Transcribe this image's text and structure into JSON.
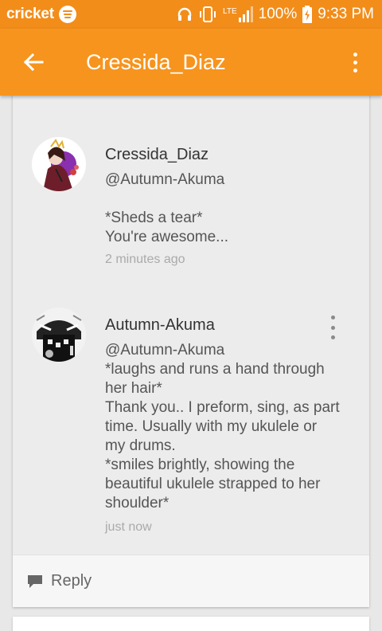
{
  "status_bar": {
    "carrier": "cricket",
    "network": "LTE",
    "battery": "100%",
    "time": "9:33 PM"
  },
  "header": {
    "title": "Cressida_Diaz"
  },
  "colors": {
    "accent": "#f7941d",
    "status_bar": "#f28d1a"
  },
  "comments": [
    {
      "author": "Cressida_Diaz",
      "mention": "@Autumn-Akuma",
      "lines": [
        "*Sheds a tear*",
        "You're awesome..."
      ],
      "time": "2 minutes ago"
    },
    {
      "author": "Autumn-Akuma",
      "mention": "@Autumn-Akuma",
      "lines": [
        "*laughs and runs a hand through",
        "her hair*",
        "Thank you.. I preform, sing, as part",
        "time. Usually with my ukulele or",
        "my drums.",
        "*smiles brightly, showing the",
        "beautiful ukulele strapped to her",
        "shoulder*"
      ],
      "time": "just now"
    }
  ],
  "reply": {
    "label": "Reply"
  }
}
